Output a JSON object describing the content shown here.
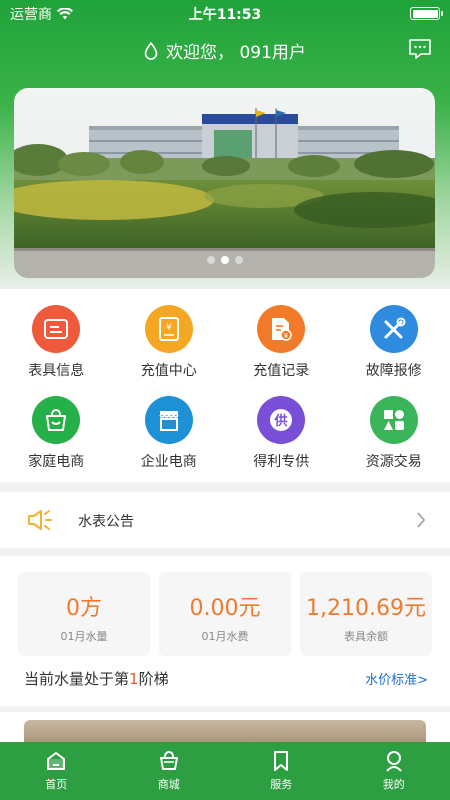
{
  "status_bar": {
    "carrier": "运营商",
    "time": "上午11:53"
  },
  "header": {
    "welcome": "欢迎您， 091用户"
  },
  "icon_grid": [
    {
      "label": "表具信息",
      "icon": "meter-info-icon",
      "color": "#f05a3c"
    },
    {
      "label": "充值中心",
      "icon": "recharge-center-icon",
      "color": "#f5a623"
    },
    {
      "label": "充值记录",
      "icon": "recharge-record-icon",
      "color": "#f27a28"
    },
    {
      "label": "故障报修",
      "icon": "repair-icon",
      "color": "#2f8be0"
    },
    {
      "label": "家庭电商",
      "icon": "home-shopping-icon",
      "color": "#25b04a"
    },
    {
      "label": "企业电商",
      "icon": "enterprise-shop-icon",
      "color": "#1e90d6"
    },
    {
      "label": "得利专供",
      "icon": "special-supply-icon",
      "color": "#7a4fd8"
    },
    {
      "label": "资源交易",
      "icon": "resource-trade-icon",
      "color": "#3ab55a"
    }
  ],
  "notice": {
    "label": "水表公告"
  },
  "stats": [
    {
      "value": "0方",
      "label": "01月水量"
    },
    {
      "value": "0.00元",
      "label": "01月水费"
    },
    {
      "value": "1,210.69元",
      "label": "表具余额"
    }
  ],
  "tier": {
    "prefix": "当前水量处于第",
    "number": "1",
    "suffix": "阶梯",
    "link": "水价标准>"
  },
  "tabs": [
    {
      "label": "首页",
      "icon": "home-icon",
      "active": true
    },
    {
      "label": "商城",
      "icon": "basket-icon"
    },
    {
      "label": "服务",
      "icon": "bookmark-icon"
    },
    {
      "label": "我的",
      "icon": "user-icon"
    }
  ]
}
